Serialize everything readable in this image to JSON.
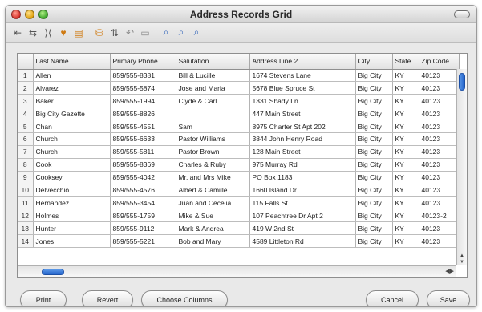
{
  "window": {
    "title": "Address Records Grid"
  },
  "toolbar": {
    "icons": [
      "first-record-icon",
      "split-view-icon",
      "stop-icon",
      "import-icon",
      "notes-icon",
      "database-icon",
      "sort-icon",
      "undo-icon",
      "folder-icon",
      "zoom-icon",
      "find-icon",
      "find-replace-icon"
    ]
  },
  "grid": {
    "columns": [
      "",
      "Last Name",
      "Primary Phone",
      "Salutation",
      "Address Line 2",
      "City",
      "State",
      "Zip Code"
    ],
    "rows": [
      [
        "1",
        "Allen",
        "859/555-8381",
        "Bill & Lucille",
        "1674 Stevens Lane",
        "Big City",
        "KY",
        "40123"
      ],
      [
        "2",
        "Alvarez",
        "859/555-5874",
        "Jose and Maria",
        "5678 Blue Spruce St",
        "Big City",
        "KY",
        "40123"
      ],
      [
        "3",
        "Baker",
        "859/555-1994",
        "Clyde & Carl",
        "1331 Shady Ln",
        "Big City",
        "KY",
        "40123"
      ],
      [
        "4",
        "Big City Gazette",
        "859/555-8826",
        "",
        "447 Main Street",
        "Big City",
        "KY",
        "40123"
      ],
      [
        "5",
        "Chan",
        "859/555-4551",
        "Sam",
        "8975 Charter St Apt 202",
        "Big City",
        "KY",
        "40123"
      ],
      [
        "6",
        "Church",
        "859/555-6633",
        "Pastor Williams",
        "3844 John Henry Road",
        "Big City",
        "KY",
        "40123"
      ],
      [
        "7",
        "Church",
        "859/555-5811",
        "Pastor Brown",
        "128 Main Street",
        "Big City",
        "KY",
        "40123"
      ],
      [
        "8",
        "Cook",
        "859/555-8369",
        "Charles & Ruby",
        "975 Murray Rd",
        "Big City",
        "KY",
        "40123"
      ],
      [
        "9",
        "Cooksey",
        "859/555-4042",
        "Mr. and Mrs Mike",
        "PO Box 1183",
        "Big City",
        "KY",
        "40123"
      ],
      [
        "10",
        "Delvecchio",
        "859/555-4576",
        "Albert & Camille",
        "1660 Island Dr",
        "Big City",
        "KY",
        "40123"
      ],
      [
        "11",
        "Hernandez",
        "859/555-3454",
        "Juan and Cecelia",
        "115 Falls St",
        "Big City",
        "KY",
        "40123"
      ],
      [
        "12",
        "Holmes",
        "859/555-1759",
        "Mike & Sue",
        "107 Peachtree Dr  Apt 2",
        "Big City",
        "KY",
        "40123-2"
      ],
      [
        "13",
        "Hunter",
        "859/555-9112",
        "Mark & Andrea",
        "419 W 2nd St",
        "Big City",
        "KY",
        "40123"
      ],
      [
        "14",
        "Jones",
        "859/555-5221",
        "Bob and Mary",
        "4589 Littleton Rd",
        "Big City",
        "KY",
        "40123"
      ]
    ]
  },
  "buttons": {
    "print": "Print",
    "revert": "Revert",
    "choose_columns": "Choose Columns",
    "cancel": "Cancel",
    "save": "Save"
  }
}
